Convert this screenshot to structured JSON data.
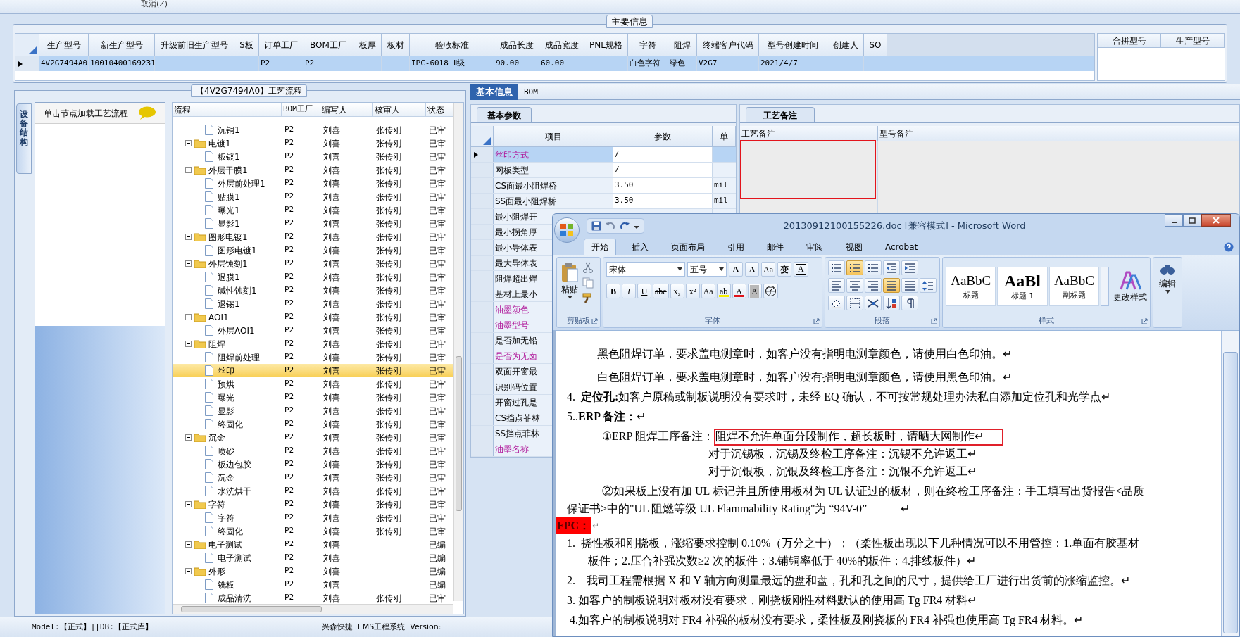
{
  "top_strip": {
    "cancel_label": "取消(Z)"
  },
  "main_info": {
    "title": "主要信息",
    "columns": [
      "生产型号",
      "新生产型号",
      "升级前旧生产型号",
      "S板",
      "订单工厂",
      "BOM工厂",
      "板厚",
      "板材",
      "验收标准",
      "成品长度",
      "成品宽度",
      "PNL规格",
      "字符",
      "阻焊",
      "终端客户代码",
      "型号创建时间",
      "创建人",
      "SO"
    ],
    "rows": [
      {
        "selected": true,
        "cells": [
          "4V2G7494A0",
          "10010400169231",
          null,
          null,
          "P2",
          "P2",
          null,
          null,
          "IPC-6018 Ⅱ级",
          "90.00",
          "60.00",
          null,
          "白色字符",
          "绿色",
          "V2G7",
          "2021/4/7",
          null,
          null
        ]
      }
    ],
    "merge_columns": [
      "合拼型号",
      "生产型号"
    ]
  },
  "process_panel": {
    "title": "【4V2G7494A0】工艺流程",
    "side_tab": "设备结构",
    "hint": "单击节点加载工艺流程",
    "columns": [
      "流程",
      "BOM工厂",
      "编写人",
      "核审人",
      "状态"
    ],
    "tree": [
      {
        "kind": "file",
        "name": "沉铜1",
        "bom": "P2",
        "writer": "刘喜",
        "reviewer": "张传刚",
        "status": "已审",
        "selected": false
      },
      {
        "kind": "folder",
        "name": "电镀1",
        "bom": "P2",
        "writer": "刘喜",
        "reviewer": "张传刚",
        "status": "已审",
        "selected": false,
        "expanded": true,
        "children": [
          {
            "kind": "file",
            "name": "板镀1",
            "bom": "P2",
            "writer": "刘喜",
            "reviewer": "张传刚",
            "status": "已审",
            "selected": false
          }
        ]
      },
      {
        "kind": "folder",
        "name": "外层干膜1",
        "bom": "P2",
        "writer": "刘喜",
        "reviewer": "张传刚",
        "status": "已审",
        "selected": false,
        "expanded": true,
        "children": [
          {
            "kind": "file",
            "name": "外层前处理1",
            "bom": "P2",
            "writer": "刘喜",
            "reviewer": "张传刚",
            "status": "已审",
            "selected": false
          },
          {
            "kind": "file",
            "name": "贴膜1",
            "bom": "P2",
            "writer": "刘喜",
            "reviewer": "张传刚",
            "status": "已审",
            "selected": false
          },
          {
            "kind": "file",
            "name": "曝光1",
            "bom": "P2",
            "writer": "刘喜",
            "reviewer": "张传刚",
            "status": "已审",
            "selected": false
          },
          {
            "kind": "file",
            "name": "显影1",
            "bom": "P2",
            "writer": "刘喜",
            "reviewer": "张传刚",
            "status": "已审",
            "selected": false
          }
        ]
      },
      {
        "kind": "folder",
        "name": "图形电镀1",
        "bom": "P2",
        "writer": "刘喜",
        "reviewer": "张传刚",
        "status": "已审",
        "selected": false,
        "expanded": true,
        "children": [
          {
            "kind": "file",
            "name": "图形电镀1",
            "bom": "P2",
            "writer": "刘喜",
            "reviewer": "张传刚",
            "status": "已审",
            "selected": false
          }
        ]
      },
      {
        "kind": "folder",
        "name": "外层蚀刻1",
        "bom": "P2",
        "writer": "刘喜",
        "reviewer": "张传刚",
        "status": "已审",
        "selected": false,
        "expanded": true,
        "children": [
          {
            "kind": "file",
            "name": "退膜1",
            "bom": "P2",
            "writer": "刘喜",
            "reviewer": "张传刚",
            "status": "已审",
            "selected": false
          },
          {
            "kind": "file",
            "name": "碱性蚀刻1",
            "bom": "P2",
            "writer": "刘喜",
            "reviewer": "张传刚",
            "status": "已审",
            "selected": false
          },
          {
            "kind": "file",
            "name": "退锡1",
            "bom": "P2",
            "writer": "刘喜",
            "reviewer": "张传刚",
            "status": "已审",
            "selected": false
          }
        ]
      },
      {
        "kind": "folder",
        "name": "AOI1",
        "bom": "P2",
        "writer": "刘喜",
        "reviewer": "张传刚",
        "status": "已审",
        "selected": false,
        "expanded": true,
        "children": [
          {
            "kind": "file",
            "name": "外层AOI1",
            "bom": "P2",
            "writer": "刘喜",
            "reviewer": "张传刚",
            "status": "已审",
            "selected": false
          }
        ]
      },
      {
        "kind": "folder",
        "name": "阻焊",
        "bom": "P2",
        "writer": "刘喜",
        "reviewer": "张传刚",
        "status": "已审",
        "selected": false,
        "expanded": true,
        "children": [
          {
            "kind": "file",
            "name": "阻焊前处理",
            "bom": "P2",
            "writer": "刘喜",
            "reviewer": "张传刚",
            "status": "已审",
            "selected": false
          },
          {
            "kind": "file",
            "name": "丝印",
            "bom": "P2",
            "writer": "刘喜",
            "reviewer": "张传刚",
            "status": "已审",
            "selected": true
          },
          {
            "kind": "file",
            "name": "预烘",
            "bom": "P2",
            "writer": "刘喜",
            "reviewer": "张传刚",
            "status": "已审",
            "selected": false
          },
          {
            "kind": "file",
            "name": "曝光",
            "bom": "P2",
            "writer": "刘喜",
            "reviewer": "张传刚",
            "status": "已审",
            "selected": false
          },
          {
            "kind": "file",
            "name": "显影",
            "bom": "P2",
            "writer": "刘喜",
            "reviewer": "张传刚",
            "status": "已审",
            "selected": false
          },
          {
            "kind": "file",
            "name": "终固化",
            "bom": "P2",
            "writer": "刘喜",
            "reviewer": "张传刚",
            "status": "已审",
            "selected": false
          }
        ]
      },
      {
        "kind": "folder",
        "name": "沉金",
        "bom": "P2",
        "writer": "刘喜",
        "reviewer": "张传刚",
        "status": "已审",
        "selected": false,
        "expanded": true,
        "children": [
          {
            "kind": "file",
            "name": "喷砂",
            "bom": "P2",
            "writer": "刘喜",
            "reviewer": "张传刚",
            "status": "已审",
            "selected": false
          },
          {
            "kind": "file",
            "name": "板边包胶",
            "bom": "P2",
            "writer": "刘喜",
            "reviewer": "张传刚",
            "status": "已审",
            "selected": false
          },
          {
            "kind": "file",
            "name": "沉金",
            "bom": "P2",
            "writer": "刘喜",
            "reviewer": "张传刚",
            "status": "已审",
            "selected": false
          },
          {
            "kind": "file",
            "name": "水洗烘干",
            "bom": "P2",
            "writer": "刘喜",
            "reviewer": "张传刚",
            "status": "已审",
            "selected": false
          }
        ]
      },
      {
        "kind": "folder",
        "name": "字符",
        "bom": "P2",
        "writer": "刘喜",
        "reviewer": "张传刚",
        "status": "已审",
        "selected": false,
        "expanded": true,
        "children": [
          {
            "kind": "file",
            "name": "字符",
            "bom": "P2",
            "writer": "刘喜",
            "reviewer": "张传刚",
            "status": "已审",
            "selected": false
          },
          {
            "kind": "file",
            "name": "终固化",
            "bom": "P2",
            "writer": "刘喜",
            "reviewer": "张传刚",
            "status": "已审",
            "selected": false
          }
        ]
      },
      {
        "kind": "folder",
        "name": "电子测试",
        "bom": "P2",
        "writer": "刘喜",
        "status": "已编",
        "selected": false,
        "expanded": true,
        "children": [
          {
            "kind": "file",
            "name": "电子测试",
            "bom": "P2",
            "writer": "刘喜",
            "status": "已编",
            "selected": false
          }
        ]
      },
      {
        "kind": "folder",
        "name": "外形",
        "bom": "P2",
        "writer": "刘喜",
        "status": "已编",
        "selected": false,
        "expanded": true,
        "children": [
          {
            "kind": "file",
            "name": "铣板",
            "bom": "P2",
            "writer": "刘喜",
            "status": "已编",
            "selected": false
          },
          {
            "kind": "file",
            "name": "成品清洗",
            "bom": "P2",
            "writer": "刘喜",
            "reviewer": "张传刚",
            "status": "已审",
            "selected": false
          }
        ]
      }
    ]
  },
  "detail_panel": {
    "tabs": [
      {
        "label": "基本信息",
        "selected": true
      },
      {
        "label": "BOM",
        "selected": false
      }
    ],
    "params_tab": "基本参数",
    "params_columns": [
      "项目",
      "参数",
      "单"
    ],
    "params": [
      {
        "item": "丝印方式",
        "value": "/",
        "highlighted": true,
        "selected": true
      },
      {
        "item": "网板类型",
        "value": "/",
        "highlighted": false,
        "selected": false
      },
      {
        "item": "CS面最小阻焊桥",
        "value": "3.50",
        "unit": "mil",
        "highlighted": false,
        "selected": false
      },
      {
        "item": "SS面最小阻焊桥",
        "value": "3.50",
        "unit": "mil",
        "highlighted": false,
        "selected": false
      },
      {
        "item": "最小阻焊开",
        "highlighted": false,
        "selected": false
      },
      {
        "item": "最小拐角厚",
        "highlighted": false,
        "selected": false
      },
      {
        "item": "最小导体表",
        "highlighted": false,
        "selected": false
      },
      {
        "item": "最大导体表",
        "highlighted": false,
        "selected": false
      },
      {
        "item": "阻焊超出焊",
        "highlighted": false,
        "selected": false
      },
      {
        "item": "基材上最小",
        "highlighted": false,
        "selected": false
      },
      {
        "item": "油墨颜色",
        "highlighted": true,
        "selected": false
      },
      {
        "item": "油墨型号",
        "highlighted": true,
        "selected": false
      },
      {
        "item": "是否加无铅",
        "highlighted": false,
        "selected": false
      },
      {
        "item": "是否为无卤",
        "highlighted": true,
        "selected": false
      },
      {
        "item": "双面开窗最",
        "highlighted": false,
        "selected": false
      },
      {
        "item": "识别码位置",
        "highlighted": false,
        "selected": false
      },
      {
        "item": "开窗过孔是",
        "highlighted": false,
        "selected": false
      },
      {
        "item": "CS挡点菲林",
        "highlighted": false,
        "selected": false
      },
      {
        "item": "SS挡点菲林",
        "highlighted": false,
        "selected": false
      },
      {
        "item": "油墨名称",
        "highlighted": true,
        "selected": false
      }
    ]
  },
  "remarks_panel": {
    "tab": "工艺备注",
    "columns": [
      "工艺备注",
      "型号备注"
    ]
  },
  "status_bar": {
    "left": "Model:【正式】||DB:【正式库】",
    "right": "兴森快捷  EMS工程系统  Version:"
  },
  "word_window": {
    "title": "20130912100155226.doc [兼容模式] - Microsoft Word",
    "tabs": [
      {
        "label": "开始",
        "selected": true
      },
      {
        "label": "插入",
        "selected": false
      },
      {
        "label": "页面布局",
        "selected": false
      },
      {
        "label": "引用",
        "selected": false
      },
      {
        "label": "邮件",
        "selected": false
      },
      {
        "label": "审阅",
        "selected": false
      },
      {
        "label": "视图",
        "selected": false
      },
      {
        "label": "Acrobat",
        "selected": false
      }
    ],
    "clipboard": {
      "paste": "粘贴",
      "label": "剪贴板"
    },
    "font": {
      "family": "宋体",
      "size": "五号",
      "label": "字体",
      "row1": [
        {
          "glyph": "A",
          "kind": "grow"
        },
        {
          "glyph": "A",
          "kind": "shrink"
        },
        {
          "glyph": "Aa",
          "kind": "clear"
        },
        {
          "glyph": "变",
          "kind": "phonetic"
        },
        {
          "glyph": "A",
          "kind": "border"
        }
      ],
      "row2": [
        {
          "glyph": "B",
          "kind": "bold"
        },
        {
          "glyph": "I",
          "kind": "italic"
        },
        {
          "glyph": "U",
          "kind": "underline"
        },
        {
          "glyph": "abe",
          "kind": "strike"
        },
        {
          "glyph": "x₂",
          "kind": "plain"
        },
        {
          "glyph": "x²",
          "kind": "plain"
        },
        {
          "glyph": "Aa",
          "kind": "plain"
        },
        {
          "glyph": "ab",
          "kind": "highlight"
        },
        {
          "glyph": "A",
          "kind": "fontcolor"
        },
        {
          "glyph": "A",
          "kind": "shade"
        },
        {
          "glyph": "字",
          "kind": "enclosed"
        }
      ]
    },
    "paragraph": {
      "label": "段落",
      "rows": [
        [
          {
            "kind": "bullets",
            "on": false
          },
          {
            "kind": "numbering",
            "on": true
          },
          {
            "kind": "multilevel",
            "on": false
          },
          {
            "kind": "outdent",
            "on": false
          },
          {
            "kind": "indent",
            "on": false
          }
        ],
        [
          {
            "kind": "left",
            "on": false
          },
          {
            "kind": "center",
            "on": false
          },
          {
            "kind": "right",
            "on": false
          },
          {
            "kind": "justify",
            "on": true
          },
          {
            "kind": "distribute",
            "on": false
          },
          {
            "kind": "spacing",
            "on": false
          }
        ],
        [
          {
            "kind": "shading",
            "on": false
          },
          {
            "kind": "borders",
            "on": false
          },
          {
            "kind": "asian",
            "on": false
          },
          {
            "kind": "sort",
            "on": false
          },
          {
            "kind": "marks",
            "on": false
          }
        ]
      ]
    },
    "styles": {
      "label": "样式",
      "change": "更改样式",
      "gallery": [
        {
          "sample": "AaBbC",
          "name": "标题",
          "kind": "normal"
        },
        {
          "sample": "AaBl",
          "name": "标题 1",
          "kind": "large"
        },
        {
          "sample": "AaBbC",
          "name": "副标题",
          "kind": "normal"
        }
      ]
    },
    "editing": {
      "label": "编辑"
    },
    "document": [
      {
        "kind": "indent",
        "text": "黑色阻焊订单，要求盖电测章时，如客户没有指明电测章颜色，请使用白色印油。↵"
      },
      {
        "kind": "indent",
        "text": "白色阻焊订单，要求盖电测章时，如客户没有指明电测章颜色，请使用黑色印油。↵"
      },
      {
        "kind": "item",
        "text": "4.  **定位孔:**如客户原稿或制板说明没有要求时，未经 EQ 确认，不可按常规处理办法私自添加定位孔和光学点↵"
      },
      {
        "kind": "item",
        "text": "5..**ERP 备注：**↵"
      },
      {
        "kind": "note",
        "text": "①ERP 阻焊工序备注：",
        "marked": "阻焊不允许单面分段制作，超长板时，请晒大网制作↵"
      },
      {
        "kind": "sub",
        "text": "对于沉锡板，沉锡及终检工序备注：沉锡不允许返工↵"
      },
      {
        "kind": "sub",
        "text": "对于沉银板，沉银及终检工序备注：沉银不允许返工↵"
      },
      {
        "kind": "note",
        "text": "②如果板上没有加 UL 标记并且所使用板材为 UL 认证过的板材，则在终检工序备注：手工填写出货报告<品质保证书>中的\"UL 阻燃等级 UL Flammability Rating\"为 “94V-0”            ↵"
      },
      {
        "kind": "tag",
        "text": "FPC：",
        "mark": "↵"
      },
      {
        "kind": "hanging",
        "text": "1.  挠性板和刚挠板，涨缩要求控制 0.10%（万分之十）；（柔性板出现以下几种情况可以不用管控：1.单面有胶基材板件；2.压合补强次数≥2 次的板件；3.铺铜率低于 40%的板件；4.排线板件）↵"
      },
      {
        "kind": "item",
        "text": "2.    我司工程需根据 X 和 Y 轴方向测量最远的盘和盘，孔和孔之间的尺寸，提供给工厂进行出货前的涨缩监控。↵"
      },
      {
        "kind": "item",
        "text": "3. 如客户的制板说明对板材没有要求，刚挠板刚性材料默认的使用高 Tg FR4 材料↵"
      },
      {
        "kind": "item",
        "text": " 4.如客户的制板说明对 FR4 补强的板材没有要求，柔性板及刚挠板的 FR4 补强也使用高 Tg FR4 材料。↵"
      }
    ]
  }
}
